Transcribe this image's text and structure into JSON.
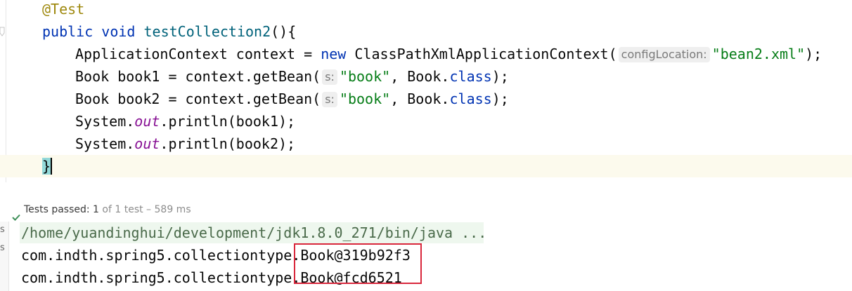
{
  "editor": {
    "annotation": "@Test",
    "method": {
      "modifier": "public",
      "type": "void",
      "name": "testCollection2",
      "params": "(){"
    },
    "line3": {
      "decl": "ApplicationContext context = ",
      "kw": "new",
      "call": " ClassPathXmlApplicationContext(",
      "hint": "configLocation:",
      "arg": "\"bean2.xml\"",
      "end": ");"
    },
    "line4": {
      "decl": "Book book1 = context.getBean(",
      "hint": "s:",
      "arg": "\"book\"",
      "mid": ", Book.",
      "kw": "class",
      "end": ");"
    },
    "line5": {
      "decl": "Book book2 = context.getBean(",
      "hint": "s:",
      "arg": "\"book\"",
      "mid": ", Book.",
      "kw": "class",
      "end": ");"
    },
    "line6": {
      "pre": "System.",
      "field": "out",
      "post": ".println(book1);"
    },
    "line7": {
      "pre": "System.",
      "field": "out",
      "post": ".println(book2);"
    },
    "closing_brace": "}"
  },
  "status": {
    "label": "Tests passed:",
    "passed": "1",
    "rest": "of 1 test – 589 ms"
  },
  "console": {
    "command": "/home/yuandinghui/development/jdk1.8.0_271/bin/java ...",
    "line1": "com.indth.spring5.collectiontype.Book@319b92f3",
    "line2": "com.indth.spring5.collectiontype.Book@fcd6521",
    "gutter": [
      "s",
      "s"
    ]
  },
  "colors": {
    "keyword": "#0033b3",
    "string": "#067d17",
    "annotation": "#9e880d",
    "field": "#871094",
    "highlight_box": "#d9273c",
    "pass_check": "#3d8f58"
  }
}
